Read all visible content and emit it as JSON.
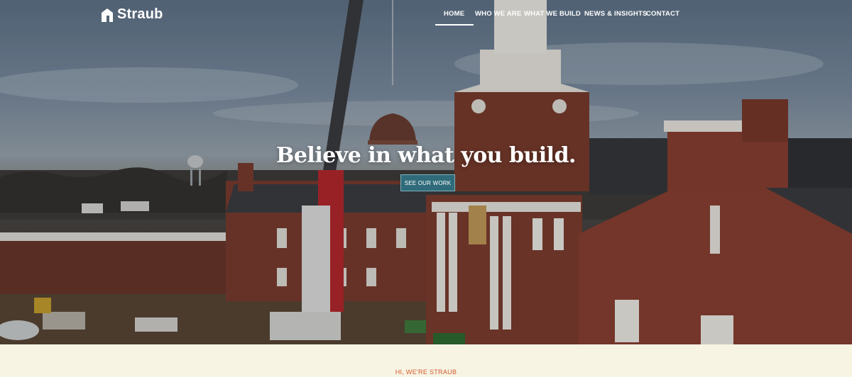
{
  "header": {
    "brand": "Straub"
  },
  "nav": {
    "items": [
      {
        "label": "HOME",
        "active": true
      },
      {
        "label": "WHO WE ARE",
        "active": false
      },
      {
        "label": "WHAT WE BUILD",
        "active": false
      },
      {
        "label": "NEWS & INSIGHTS",
        "active": false
      },
      {
        "label": "CONTACT",
        "active": false
      }
    ]
  },
  "hero": {
    "headline": "Believe in what you build.",
    "cta_label": "SEE OUR WORK",
    "image_subject": "aerial photo of brick campus building with cupola being lifted by crane"
  },
  "intro": {
    "eyebrow": "HI, WE'RE STRAUB"
  },
  "colors": {
    "cta_background": "#2f6b7a",
    "eyebrow": "#d55a2b",
    "page_background": "#f7f4e4",
    "brick": "#8a3e2e"
  }
}
